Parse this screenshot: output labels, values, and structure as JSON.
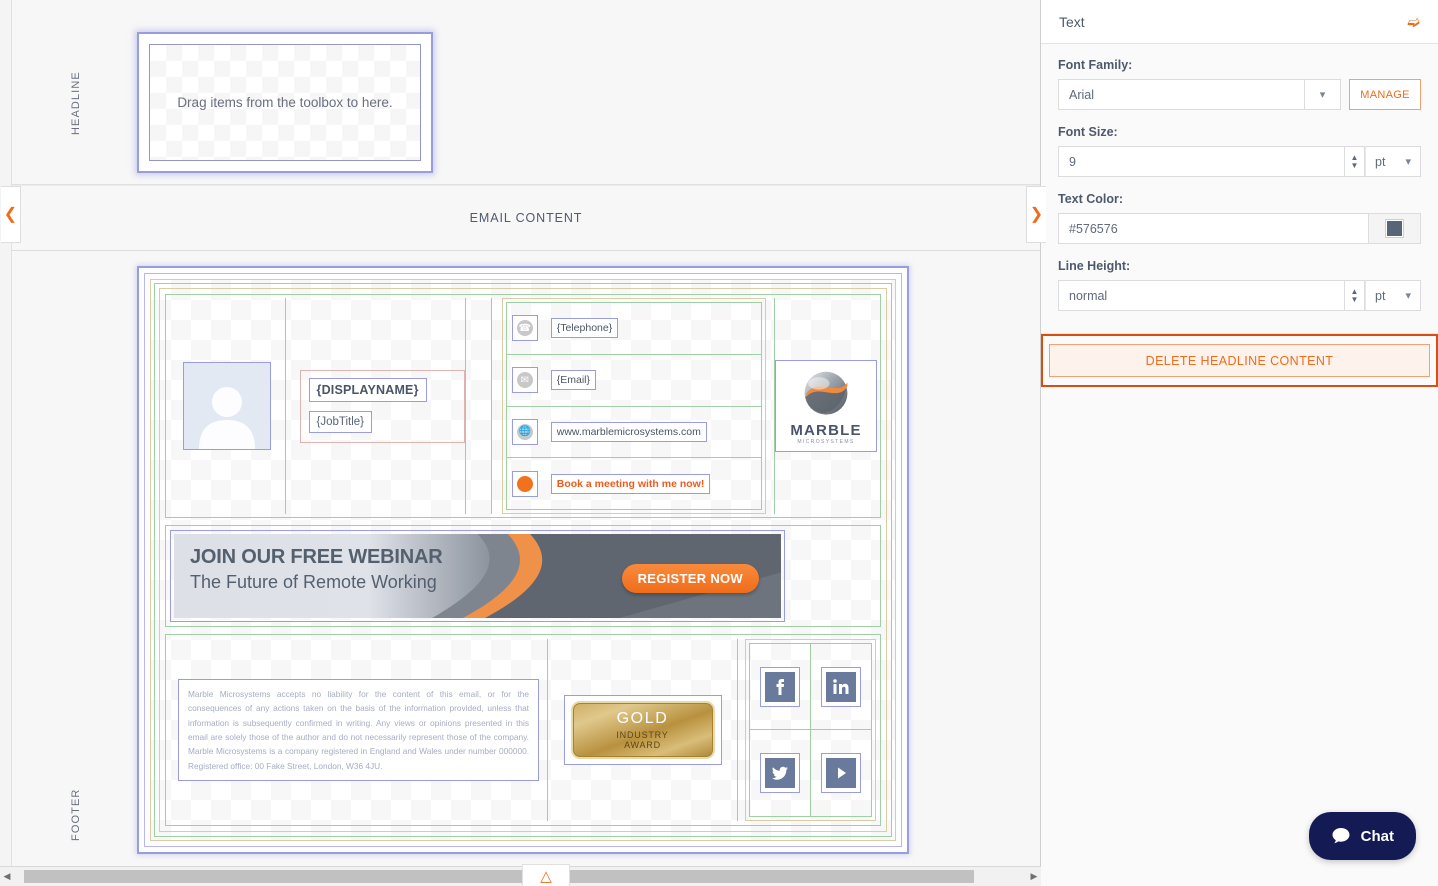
{
  "editor": {
    "headline_band": {
      "rot_label": "HEADLINE",
      "dropzone_text": "Drag items from the toolbox to here."
    },
    "email_content_band": {
      "title": "EMAIL CONTENT",
      "left_tab_icon": "chevron-left-icon",
      "right_tab_icon": "chevron-right-icon"
    },
    "footer_band": {
      "rot_label": "FOOTER"
    },
    "signature": {
      "person": {
        "avatar_icon": "avatar-placeholder-icon",
        "display_name": "{DISPLAYNAME}",
        "job_title": "{JobTitle}"
      },
      "contacts": [
        {
          "icon": "phone-icon",
          "value": "{Telephone}",
          "is_link": false
        },
        {
          "icon": "envelope-icon",
          "value": "{Email}",
          "is_link": false
        },
        {
          "icon": "globe-icon",
          "value": "www.marblemicrosystems.com",
          "is_link": false
        },
        {
          "icon": "orange-dot-icon",
          "value": "Book a meeting with me now!",
          "is_link": true
        }
      ],
      "logo": {
        "name": "MARBLE",
        "subtitle": "MICROSYSTEMS"
      },
      "banner": {
        "headline": "JOIN OUR FREE WEBINAR",
        "subhead": "The Future of Remote Working",
        "cta": "REGISTER NOW"
      },
      "disclaimer": "Marble Microsystems accepts no liability for the content of this email, or for the consequences of any actions taken on the basis of the information provided, unless that information is subsequently confirmed in writing. Any views or opinions presented in this email are solely those of the author and do not necessarily represent those of the company. Marble Microsystems is a company registered in England and Wales under number 000000. Registered office: 00 Fake Street, London, W36 4JU.",
      "award": {
        "line1": "GOLD",
        "line2": "INDUSTRY",
        "line3": "AWARD"
      },
      "social": [
        {
          "icon": "facebook-icon",
          "glyph": "f"
        },
        {
          "icon": "linkedin-icon",
          "glyph": "in"
        },
        {
          "icon": "twitter-icon",
          "glyph": "t"
        },
        {
          "icon": "youtube-icon",
          "glyph": "play"
        }
      ]
    },
    "scrollbar": {
      "left_arrow": "◀",
      "right_arrow": "▶",
      "collapse_icon": "chevron-up-icon"
    }
  },
  "panel": {
    "title": "Text",
    "collapse_icon": "chevron-down-icon",
    "font_family": {
      "label": "Font Family:",
      "value": "Arial",
      "manage_label": "MANAGE"
    },
    "font_size": {
      "label": "Font Size:",
      "value": "9",
      "unit": "pt"
    },
    "text_color": {
      "label": "Text Color:",
      "value": "#576576",
      "swatch_hex": "#576576"
    },
    "line_height": {
      "label": "Line Height:",
      "value": "normal",
      "unit": "pt"
    },
    "delete_button": "DELETE HEADLINE CONTENT"
  },
  "chat": {
    "label": "Chat",
    "icon": "chat-bubble-icon"
  },
  "colors": {
    "accent_orange": "#ef6c1a",
    "selection_purple": "#9a9ce0",
    "grid_green": "#9fd0a5",
    "grid_tan": "#d9cda5",
    "text_slate": "#576576",
    "chat_navy": "#141a53"
  }
}
